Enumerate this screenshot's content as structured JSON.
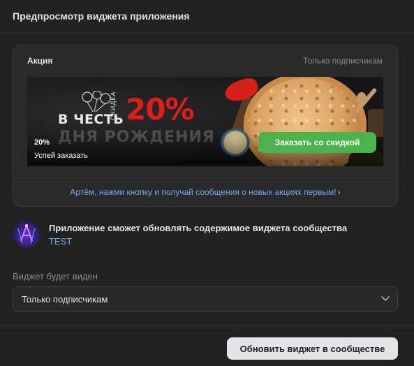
{
  "header": {
    "title": "Предпросмотр виджета приложения"
  },
  "widget": {
    "title": "Акция",
    "audience_note": "Только подписчикам",
    "banner": {
      "promo_line1": "В ЧЕСТЬ",
      "promo_line2": "ДНЯ РОЖДЕНИЯ",
      "promo_vertical": "СКИДКА",
      "promo_percent": "20%",
      "discount": "20%",
      "subtitle": "Успей заказать",
      "button_label": "Заказать со скидкой",
      "button_color": "#4bb34b",
      "accent_color": "#e11c1c"
    },
    "footer_link": "Артём, нажми кнопку и получай сообщения о новых акциях первым!",
    "footer_link_color": "#71aaeb"
  },
  "app": {
    "permission_text": "Приложение сможет обновлять содержимое виджета сообщества",
    "name": "TEST"
  },
  "visibility": {
    "label": "Виджет будет виден",
    "selected": "Только подписчикам"
  },
  "footer": {
    "update_button": "Обновить виджет в сообществе"
  }
}
